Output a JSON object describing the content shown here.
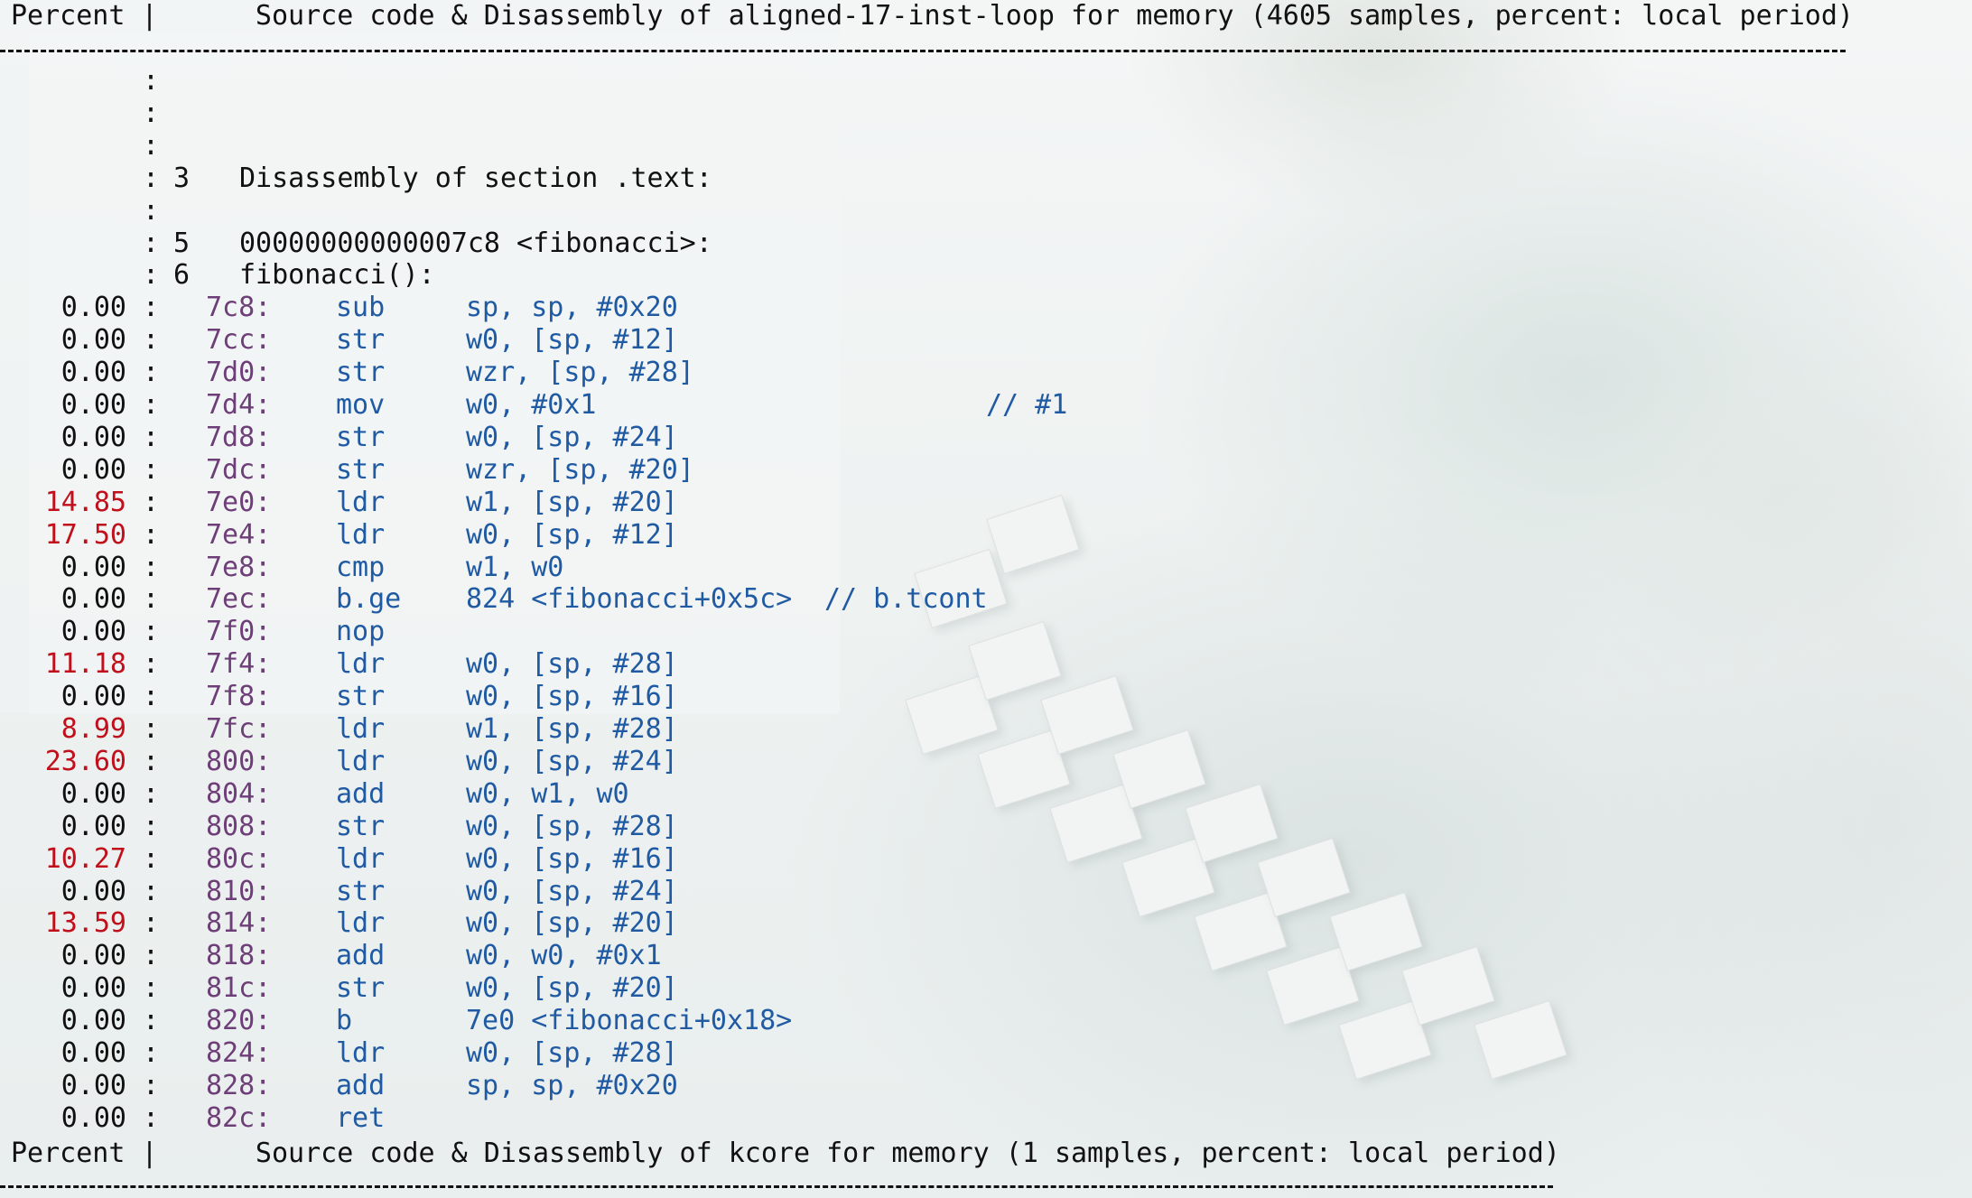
{
  "header_top": {
    "text": "Percent |      Source code & Disassembly of aligned-17-inst-loop for memory (4605 samples, percent: local period)"
  },
  "header_bottom": {
    "text": "Percent |      Source code & Disassembly of kcore for memory (1 samples, percent: local period)"
  },
  "source_lines": [
    {
      "line_no": "",
      "text": ""
    },
    {
      "line_no": "",
      "text": ""
    },
    {
      "line_no": "",
      "text": ""
    },
    {
      "line_no": "3",
      "text": "Disassembly of section .text:"
    },
    {
      "line_no": "",
      "text": ""
    },
    {
      "line_no": "5",
      "text": "00000000000007c8 <fibonacci>:"
    },
    {
      "line_no": "6",
      "text": "fibonacci():"
    }
  ],
  "instructions": [
    {
      "pct": "0.00",
      "hot": false,
      "addr": "7c8:",
      "mnemonic": "sub",
      "operands": "sp, sp, #0x20",
      "comment": ""
    },
    {
      "pct": "0.00",
      "hot": false,
      "addr": "7cc:",
      "mnemonic": "str",
      "operands": "w0, [sp, #12]",
      "comment": ""
    },
    {
      "pct": "0.00",
      "hot": false,
      "addr": "7d0:",
      "mnemonic": "str",
      "operands": "wzr, [sp, #28]",
      "comment": ""
    },
    {
      "pct": "0.00",
      "hot": false,
      "addr": "7d4:",
      "mnemonic": "mov",
      "operands": "w0, #0x1",
      "comment": "// #1"
    },
    {
      "pct": "0.00",
      "hot": false,
      "addr": "7d8:",
      "mnemonic": "str",
      "operands": "w0, [sp, #24]",
      "comment": ""
    },
    {
      "pct": "0.00",
      "hot": false,
      "addr": "7dc:",
      "mnemonic": "str",
      "operands": "wzr, [sp, #20]",
      "comment": ""
    },
    {
      "pct": "14.85",
      "hot": true,
      "addr": "7e0:",
      "mnemonic": "ldr",
      "operands": "w1, [sp, #20]",
      "comment": ""
    },
    {
      "pct": "17.50",
      "hot": true,
      "addr": "7e4:",
      "mnemonic": "ldr",
      "operands": "w0, [sp, #12]",
      "comment": ""
    },
    {
      "pct": "0.00",
      "hot": false,
      "addr": "7e8:",
      "mnemonic": "cmp",
      "operands": "w1, w0",
      "comment": ""
    },
    {
      "pct": "0.00",
      "hot": false,
      "addr": "7ec:",
      "mnemonic": "b.ge",
      "operands": "824 <fibonacci+0x5c>",
      "comment": "// b.tcont"
    },
    {
      "pct": "0.00",
      "hot": false,
      "addr": "7f0:",
      "mnemonic": "nop",
      "operands": "",
      "comment": ""
    },
    {
      "pct": "11.18",
      "hot": true,
      "addr": "7f4:",
      "mnemonic": "ldr",
      "operands": "w0, [sp, #28]",
      "comment": ""
    },
    {
      "pct": "0.00",
      "hot": false,
      "addr": "7f8:",
      "mnemonic": "str",
      "operands": "w0, [sp, #16]",
      "comment": ""
    },
    {
      "pct": "8.99",
      "hot": true,
      "addr": "7fc:",
      "mnemonic": "ldr",
      "operands": "w1, [sp, #28]",
      "comment": ""
    },
    {
      "pct": "23.60",
      "hot": true,
      "addr": "800:",
      "mnemonic": "ldr",
      "operands": "w0, [sp, #24]",
      "comment": ""
    },
    {
      "pct": "0.00",
      "hot": false,
      "addr": "804:",
      "mnemonic": "add",
      "operands": "w0, w1, w0",
      "comment": ""
    },
    {
      "pct": "0.00",
      "hot": false,
      "addr": "808:",
      "mnemonic": "str",
      "operands": "w0, [sp, #28]",
      "comment": ""
    },
    {
      "pct": "10.27",
      "hot": true,
      "addr": "80c:",
      "mnemonic": "ldr",
      "operands": "w0, [sp, #16]",
      "comment": ""
    },
    {
      "pct": "0.00",
      "hot": false,
      "addr": "810:",
      "mnemonic": "str",
      "operands": "w0, [sp, #24]",
      "comment": ""
    },
    {
      "pct": "13.59",
      "hot": true,
      "addr": "814:",
      "mnemonic": "ldr",
      "operands": "w0, [sp, #20]",
      "comment": ""
    },
    {
      "pct": "0.00",
      "hot": false,
      "addr": "818:",
      "mnemonic": "add",
      "operands": "w0, w0, #0x1",
      "comment": ""
    },
    {
      "pct": "0.00",
      "hot": false,
      "addr": "81c:",
      "mnemonic": "str",
      "operands": "w0, [sp, #20]",
      "comment": ""
    },
    {
      "pct": "0.00",
      "hot": false,
      "addr": "820:",
      "mnemonic": "b",
      "operands": "7e0 <fibonacci+0x18>",
      "comment": ""
    },
    {
      "pct": "0.00",
      "hot": false,
      "addr": "824:",
      "mnemonic": "ldr",
      "operands": "w0, [sp, #28]",
      "comment": ""
    },
    {
      "pct": "0.00",
      "hot": false,
      "addr": "828:",
      "mnemonic": "add",
      "operands": "sp, sp, #0x20",
      "comment": ""
    },
    {
      "pct": "0.00",
      "hot": false,
      "addr": "82c:",
      "mnemonic": "ret",
      "operands": "",
      "comment": ""
    }
  ],
  "colors": {
    "hot_percent": "#c0101b",
    "address": "#6e3e78",
    "instruction": "#1f5aa3",
    "text": "#111111"
  }
}
